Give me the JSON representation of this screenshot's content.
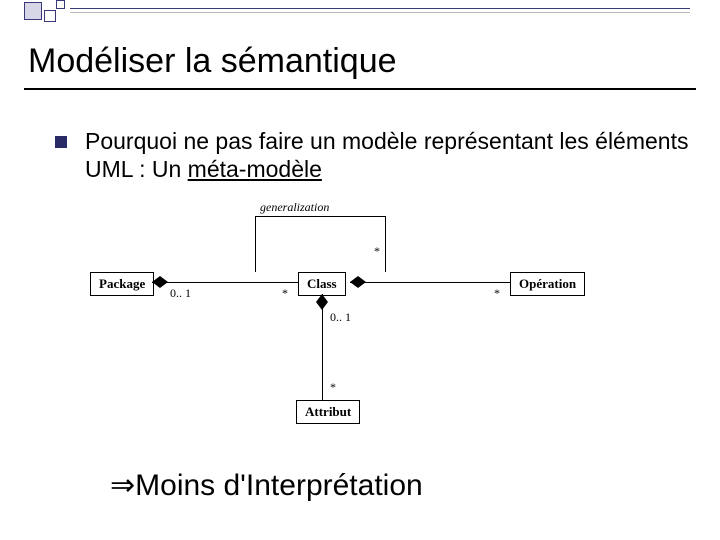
{
  "slide": {
    "title": "Modéliser la sémantique",
    "bullet_text_1": "Pourquoi ne pas faire un modèle représentant les éléments UML : Un ",
    "bullet_text_2": "méta-modèle"
  },
  "diagram": {
    "generalization_label": "generalization",
    "boxes": {
      "package": "Package",
      "class": "Class",
      "operation": "Opération",
      "attribut": "Attribut"
    },
    "mult": {
      "zero_one_a": "0.. 1",
      "star_a": "*",
      "star_gen_top": "*",
      "zero_one_b": "0.. 1",
      "star_b": "*",
      "star_op": "*",
      "star_attr": "*"
    }
  },
  "conclusion": {
    "arrow": "⇒",
    "text": "Moins d'Interprétation"
  }
}
